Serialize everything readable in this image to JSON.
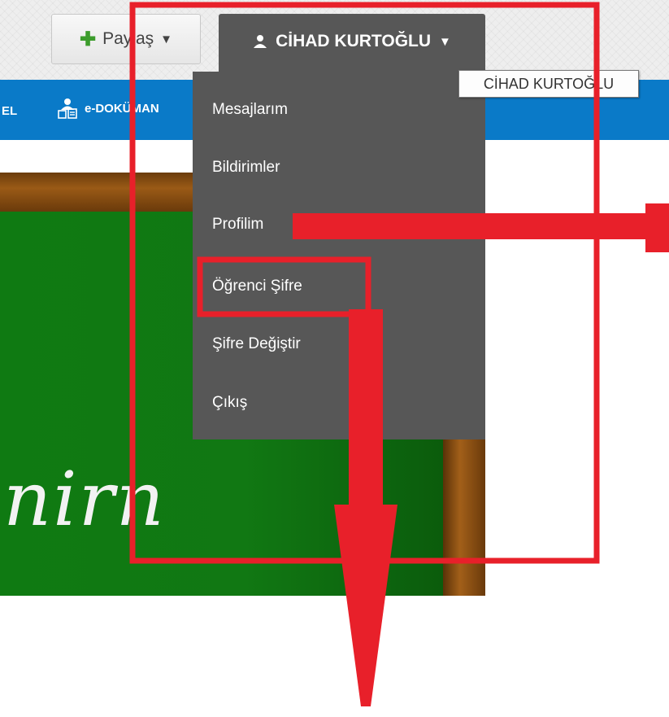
{
  "toolbar": {
    "share_label": "Paylaş",
    "share_icon": "plus-icon",
    "user_name": "CİHAD KURTOĞLU",
    "user_icon": "user-icon",
    "caret_icon": "caret-down-icon"
  },
  "tooltip": {
    "text": "CİHAD KURTOĞLU"
  },
  "nav": {
    "partial_left_label": "EL",
    "edokuman_label": "e-DOKÜMAN",
    "edokuman_icon": "document-user-icon"
  },
  "user_menu": {
    "items": [
      {
        "label": "Mesajlarım"
      },
      {
        "label": "Bildirimler"
      },
      {
        "label": "Profilim"
      },
      {
        "label": "Öğrenci Şifre"
      },
      {
        "label": "Şifre Değiştir"
      },
      {
        "label": "Çıkış"
      }
    ]
  },
  "banner": {
    "chalk_text": "nirn"
  },
  "colors": {
    "accent_blue": "#0a7ac8",
    "menu_bg": "#575757",
    "annotation_red": "#e8202a",
    "board_green": "#117813"
  }
}
